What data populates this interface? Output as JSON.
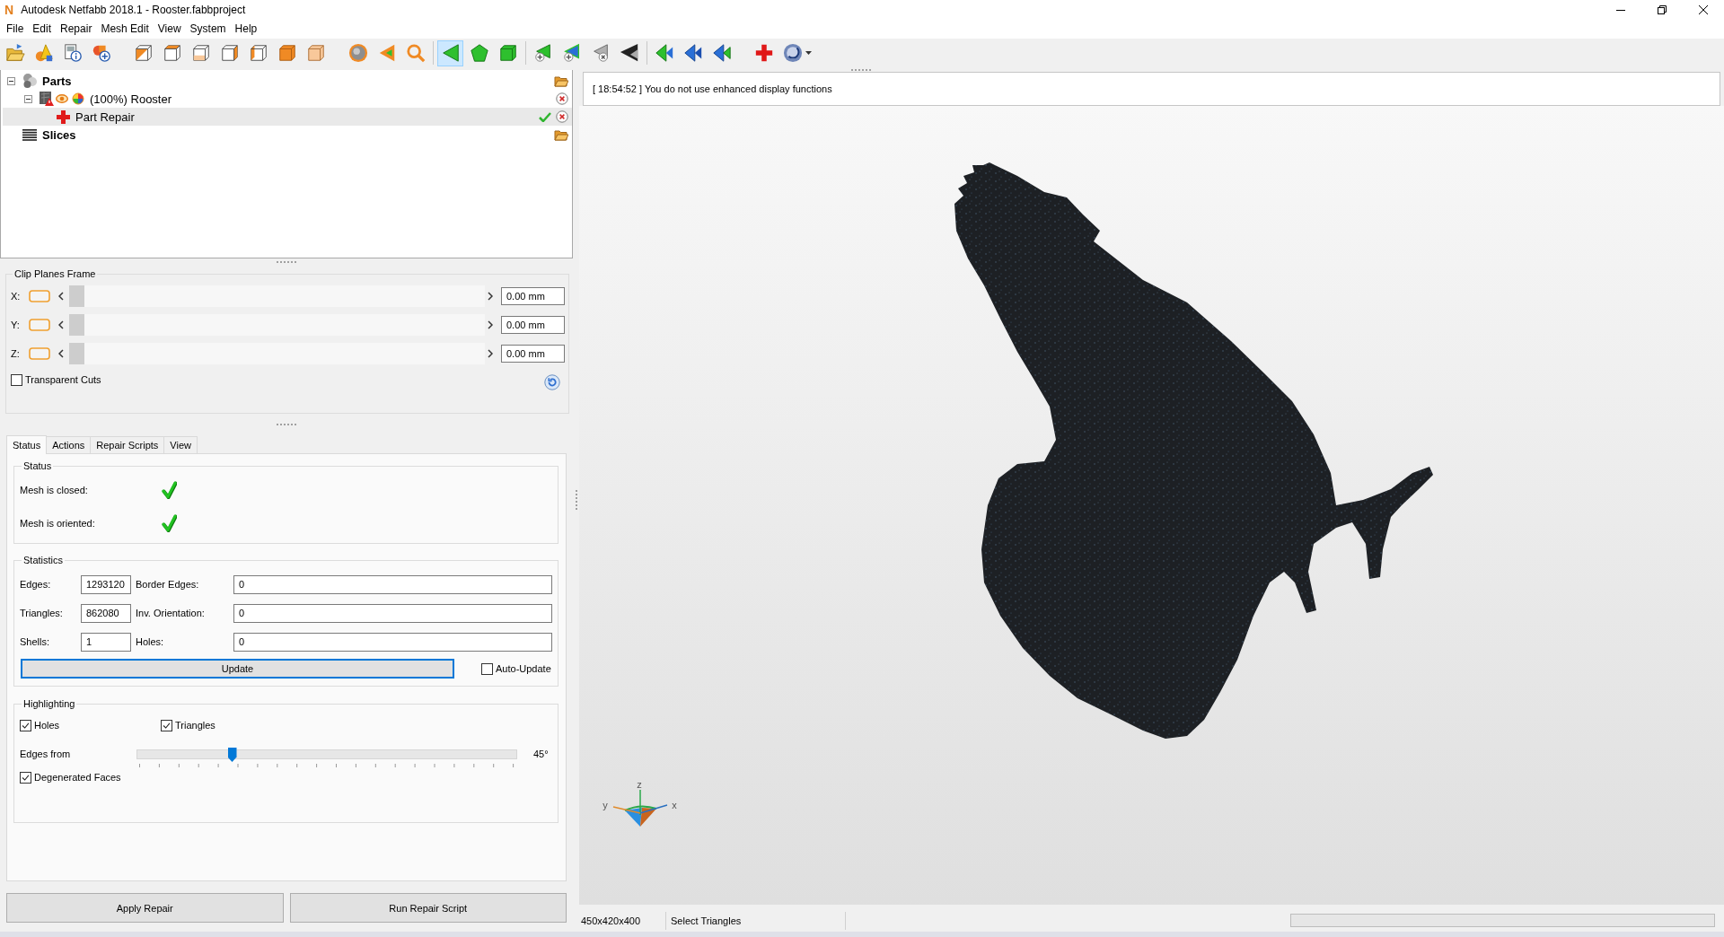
{
  "window": {
    "logo": "N",
    "title": "Autodesk Netfabb 2018.1 - Rooster.fabbproject"
  },
  "menu": [
    "File",
    "Edit",
    "Repair",
    "Mesh Edit",
    "View",
    "System",
    "Help"
  ],
  "toolbar": {
    "groups": [
      {
        "separated": false,
        "buttons": [
          {
            "selected": false
          },
          {
            "selected": false
          },
          {
            "selected": false
          },
          {
            "selected": false
          }
        ]
      },
      {
        "separated": false,
        "buttons": [
          {
            "selected": false
          },
          {
            "selected": false
          },
          {
            "selected": false
          },
          {
            "selected": false
          },
          {
            "selected": false
          },
          {
            "selected": false
          },
          {
            "selected": false
          }
        ]
      },
      {
        "separated": false,
        "buttons": [
          {
            "selected": false
          },
          {
            "selected": false
          },
          {
            "selected": false
          }
        ]
      },
      {
        "separated": true,
        "buttons": [
          {
            "selected": true
          },
          {
            "selected": false
          },
          {
            "selected": false
          }
        ]
      },
      {
        "separated": true,
        "buttons": [
          {
            "selected": false
          },
          {
            "selected": false
          },
          {
            "selected": false
          },
          {
            "selected": false
          }
        ]
      },
      {
        "separated": true,
        "buttons": [
          {
            "selected": false
          },
          {
            "selected": false
          },
          {
            "selected": false
          }
        ]
      },
      {
        "separated": false,
        "buttons": [
          {
            "kind": "button",
            "selected": false
          },
          {
            "kind": "dropdown",
            "selected": false
          }
        ]
      }
    ]
  },
  "tree": [
    {
      "label": "Parts",
      "kind": "group",
      "selected": false,
      "expanded": true,
      "children": [
        {
          "label": "(100%) Rooster",
          "kind": "part",
          "selected": false,
          "expanded": true,
          "children": [
            {
              "label": "Part Repair",
              "kind": "repair",
              "selected": true
            }
          ]
        }
      ]
    },
    {
      "label": "Slices",
      "kind": "slices",
      "selected": false
    }
  ],
  "clip_planes": {
    "title": "Clip Planes Frame",
    "rows": [
      {
        "axis": "X:",
        "level": 0,
        "value": "0.00 mm"
      },
      {
        "axis": "Y:",
        "level": 0,
        "value": "0.00 mm"
      },
      {
        "axis": "Z:",
        "level": 0,
        "value": "0.00 mm"
      }
    ],
    "transparent_cuts": {
      "label": "Transparent Cuts",
      "checked": false
    }
  },
  "tabs": [
    {
      "label": "Status",
      "selected": true
    },
    {
      "label": "Actions",
      "selected": false
    },
    {
      "label": "Repair Scripts",
      "selected": false
    },
    {
      "label": "View",
      "selected": false
    }
  ],
  "status_group": {
    "title": "Status",
    "checks": [
      {
        "label": "Mesh is closed:",
        "ok": true
      },
      {
        "label": "Mesh is oriented:",
        "ok": true
      }
    ]
  },
  "statistics": {
    "title": "Statistics",
    "rows": [
      {
        "left": {
          "label": "Edges:",
          "value": "1293120"
        },
        "right": {
          "label": "Border Edges:",
          "value": "0"
        }
      },
      {
        "left": {
          "label": "Triangles:",
          "value": "862080"
        },
        "right": {
          "label": "Inv. Orientation:",
          "value": "0"
        }
      },
      {
        "left": {
          "label": "Shells:",
          "value": "1"
        },
        "right": {
          "label": "Holes:",
          "value": "0"
        }
      }
    ],
    "update_button": {
      "label": "Update",
      "focused": true
    },
    "auto_update": {
      "label": "Auto-Update",
      "checked": false
    }
  },
  "highlighting": {
    "title": "Highlighting",
    "options": [
      {
        "label": "Holes",
        "checked": true
      },
      {
        "label": "Triangles",
        "checked": true
      }
    ],
    "slider": {
      "label": "Edges from",
      "level": 0.25,
      "reading": "45°"
    },
    "degenerated_faces": {
      "label": "Degenerated Faces",
      "checked": true
    }
  },
  "actions": [
    "Apply Repair",
    "Run Repair Script"
  ],
  "log": {
    "message": "[ 18:54:52 ] You do not use enhanced display functions"
  },
  "viewport": {
    "axis_labels": [
      "z",
      "y",
      "x"
    ]
  },
  "status_bar": {
    "dimensions": "450x420x400",
    "mode": "Select Triangles",
    "progress": {
      "level": 0
    }
  }
}
